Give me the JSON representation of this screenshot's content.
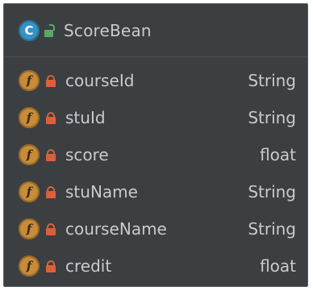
{
  "structure_panel": {
    "class": {
      "icon": "class-icon",
      "icon_letter": "C",
      "visibility_icon": "public-lock-icon",
      "name": "ScoreBean"
    },
    "fields": [
      {
        "icon_letter": "f",
        "name": "courseId",
        "type": "String"
      },
      {
        "icon_letter": "f",
        "name": "stuId",
        "type": "String"
      },
      {
        "icon_letter": "f",
        "name": "score",
        "type": "float"
      },
      {
        "icon_letter": "f",
        "name": "stuName",
        "type": "String"
      },
      {
        "icon_letter": "f",
        "name": "courseName",
        "type": "String"
      },
      {
        "icon_letter": "f",
        "name": "credit",
        "type": "float"
      }
    ],
    "colors": {
      "background": "#3c3f41",
      "text": "#c8cace",
      "class_icon": "#3592c4",
      "field_icon": "#c78b3a",
      "public_lock": "#59a869",
      "private_lock": "#d9603b"
    }
  }
}
